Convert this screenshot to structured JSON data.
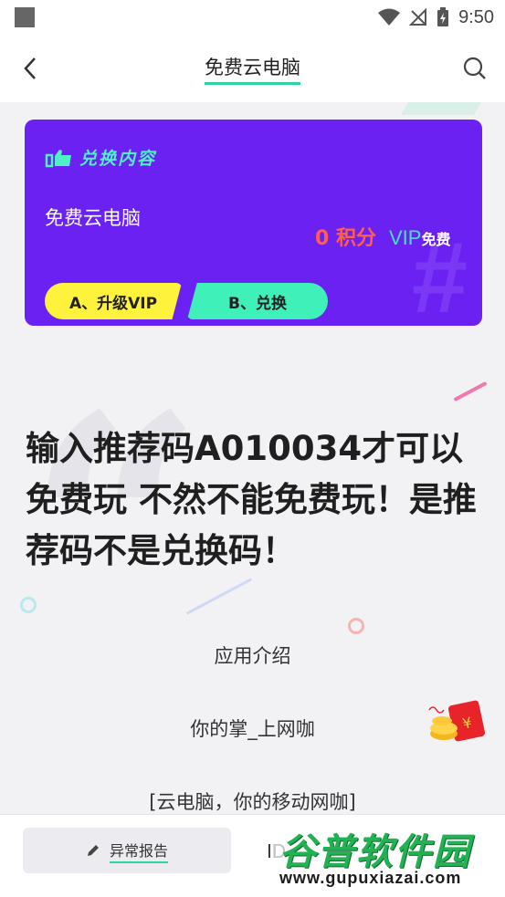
{
  "status_bar": {
    "time": "9:50",
    "icons": [
      "square-indicator-icon",
      "wifi-icon",
      "no-signal-icon",
      "battery-charging-icon"
    ]
  },
  "app_bar": {
    "title": "免费云电脑",
    "back_icon": "back-arrow-icon",
    "search_icon": "search-icon"
  },
  "card": {
    "header_label": "兑换内容",
    "app_name": "免费云电脑",
    "points": "0 积分",
    "vip_label": "VIP",
    "vip_free": "免费",
    "button_a": "A、升级VIP",
    "button_b": "B、兑换",
    "background_color": "#6a21f2",
    "button_a_color": "#fff23c",
    "button_b_color": "#3ff0b8"
  },
  "main": {
    "notice": "输入推荐码A010034才可以免费玩 不然不能免费玩！是推荐码不是兑换码！",
    "intro_title": "应用介绍",
    "intro_line1": "你的掌_上网咖",
    "intro_line2": "[云电脑，你的移动网咖]"
  },
  "bottom_bar": {
    "report_label": "异常报告",
    "report_icon": "pencil-icon",
    "next_label": "ID"
  },
  "watermark": {
    "brand": "谷普软件园",
    "url": "www.gupuxiazai.com"
  },
  "colors": {
    "accent": "#2ed3a4",
    "background": "#f2f2f5"
  }
}
